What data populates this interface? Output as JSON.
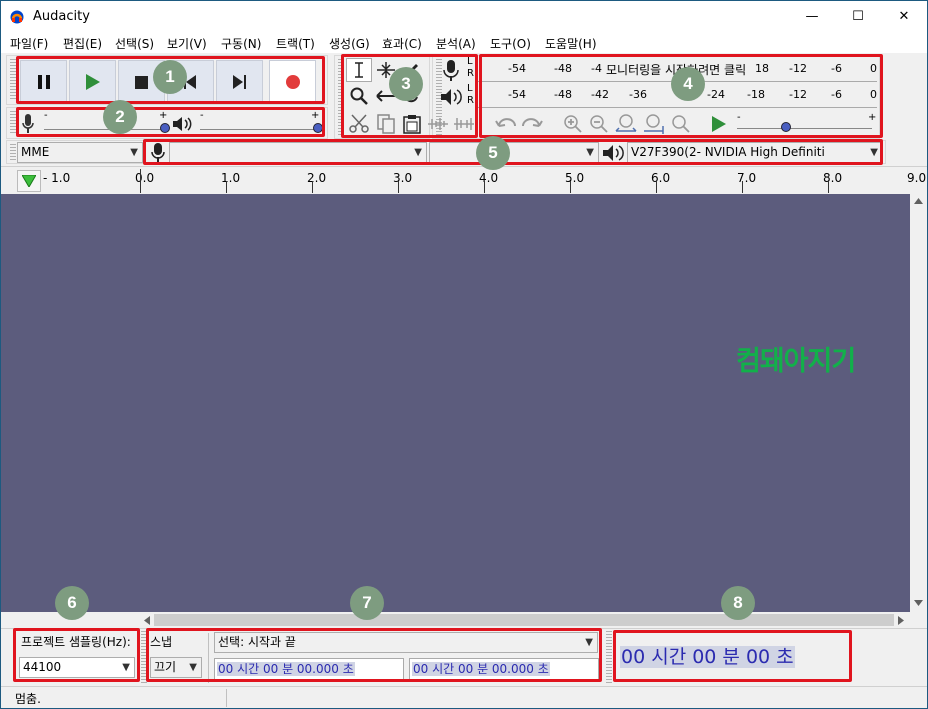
{
  "window": {
    "title": "Audacity",
    "minimize": "—",
    "maximize": "☐",
    "close": "✕"
  },
  "menu": [
    "파일(F)",
    "편집(E)",
    "선택(S)",
    "보기(V)",
    "구동(N)",
    "트랙(T)",
    "생성(G)",
    "효과(C)",
    "분석(A)",
    "도구(O)",
    "도움말(H)"
  ],
  "transport": {
    "pause": "pause-icon",
    "play": "play-icon",
    "stop": "stop-icon",
    "skip_start": "skip-start-icon",
    "skip_end": "skip-end-icon",
    "record": "record-icon"
  },
  "mixer": {
    "rec_minus": "-",
    "rec_plus": "+",
    "play_minus": "-",
    "play_plus": "+"
  },
  "meter": {
    "rec_scale": [
      "-54",
      "-48",
      "-4"
    ],
    "monitor_text": "모니터링을 시작하려면 클릭",
    "rec_scale_right": [
      "18",
      "-12",
      "-6",
      "0"
    ],
    "play_scale": [
      "-54",
      "-48",
      "-42",
      "-36",
      "-24",
      "-18",
      "-12",
      "-6",
      "0"
    ],
    "lr": [
      "L",
      "R",
      "L",
      "R"
    ],
    "playspeed_minus": "-",
    "playspeed_plus": "+"
  },
  "device": {
    "host": "MME",
    "rec_device": "",
    "rec_channels": "",
    "play_device": "V27F390(2- NVIDIA High Definiti"
  },
  "ruler": {
    "labels": [
      "- 1.0",
      "0.0",
      "1.0",
      "2.0",
      "3.0",
      "4.0",
      "5.0",
      "6.0",
      "7.0",
      "8.0",
      "9.0"
    ]
  },
  "watermark": "컴돼아지기",
  "selection": {
    "rate_label": "프로젝트 샘플링(Hz):",
    "rate_value": "44100",
    "snap_label": "스냅",
    "snap_value": "끄기",
    "mode_value": "선택: 시작과 끝",
    "start_time": "00 시간 00 분 00.000 초",
    "end_time": "00 시간 00 분 00.000 초",
    "audio_position": "00 시간 00 분 00 초"
  },
  "status": {
    "text": "멈춤."
  },
  "badges": [
    "1",
    "2",
    "3",
    "4",
    "5",
    "6",
    "7",
    "8"
  ],
  "colors": {
    "highlight": "#e0141e",
    "badge": "#7e9c80",
    "track_bg": "#5c5c7d",
    "watermark": "#12b04a"
  }
}
